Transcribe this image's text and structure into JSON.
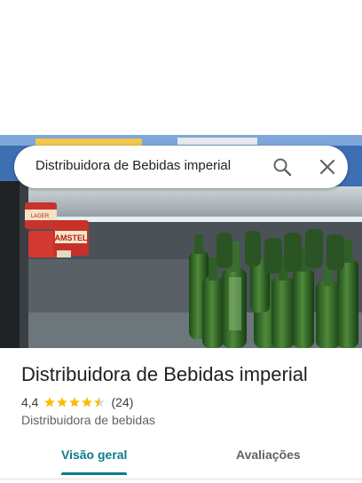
{
  "search": {
    "query": "Distribuidora de Bebidas imperial"
  },
  "photo": {
    "label": "AMSTEL",
    "sublabel": "LAGER"
  },
  "place": {
    "name": "Distribuidora de Bebidas imperial",
    "rating": "4,4",
    "rating_value": 4.4,
    "review_count": "(24)",
    "category": "Distribuidora de bebidas"
  },
  "tabs": [
    {
      "label": "Visão geral",
      "active": true
    },
    {
      "label": "Avaliações",
      "active": false
    }
  ],
  "colors": {
    "accent": "#0b7d8a",
    "star": "#fbbc04"
  }
}
